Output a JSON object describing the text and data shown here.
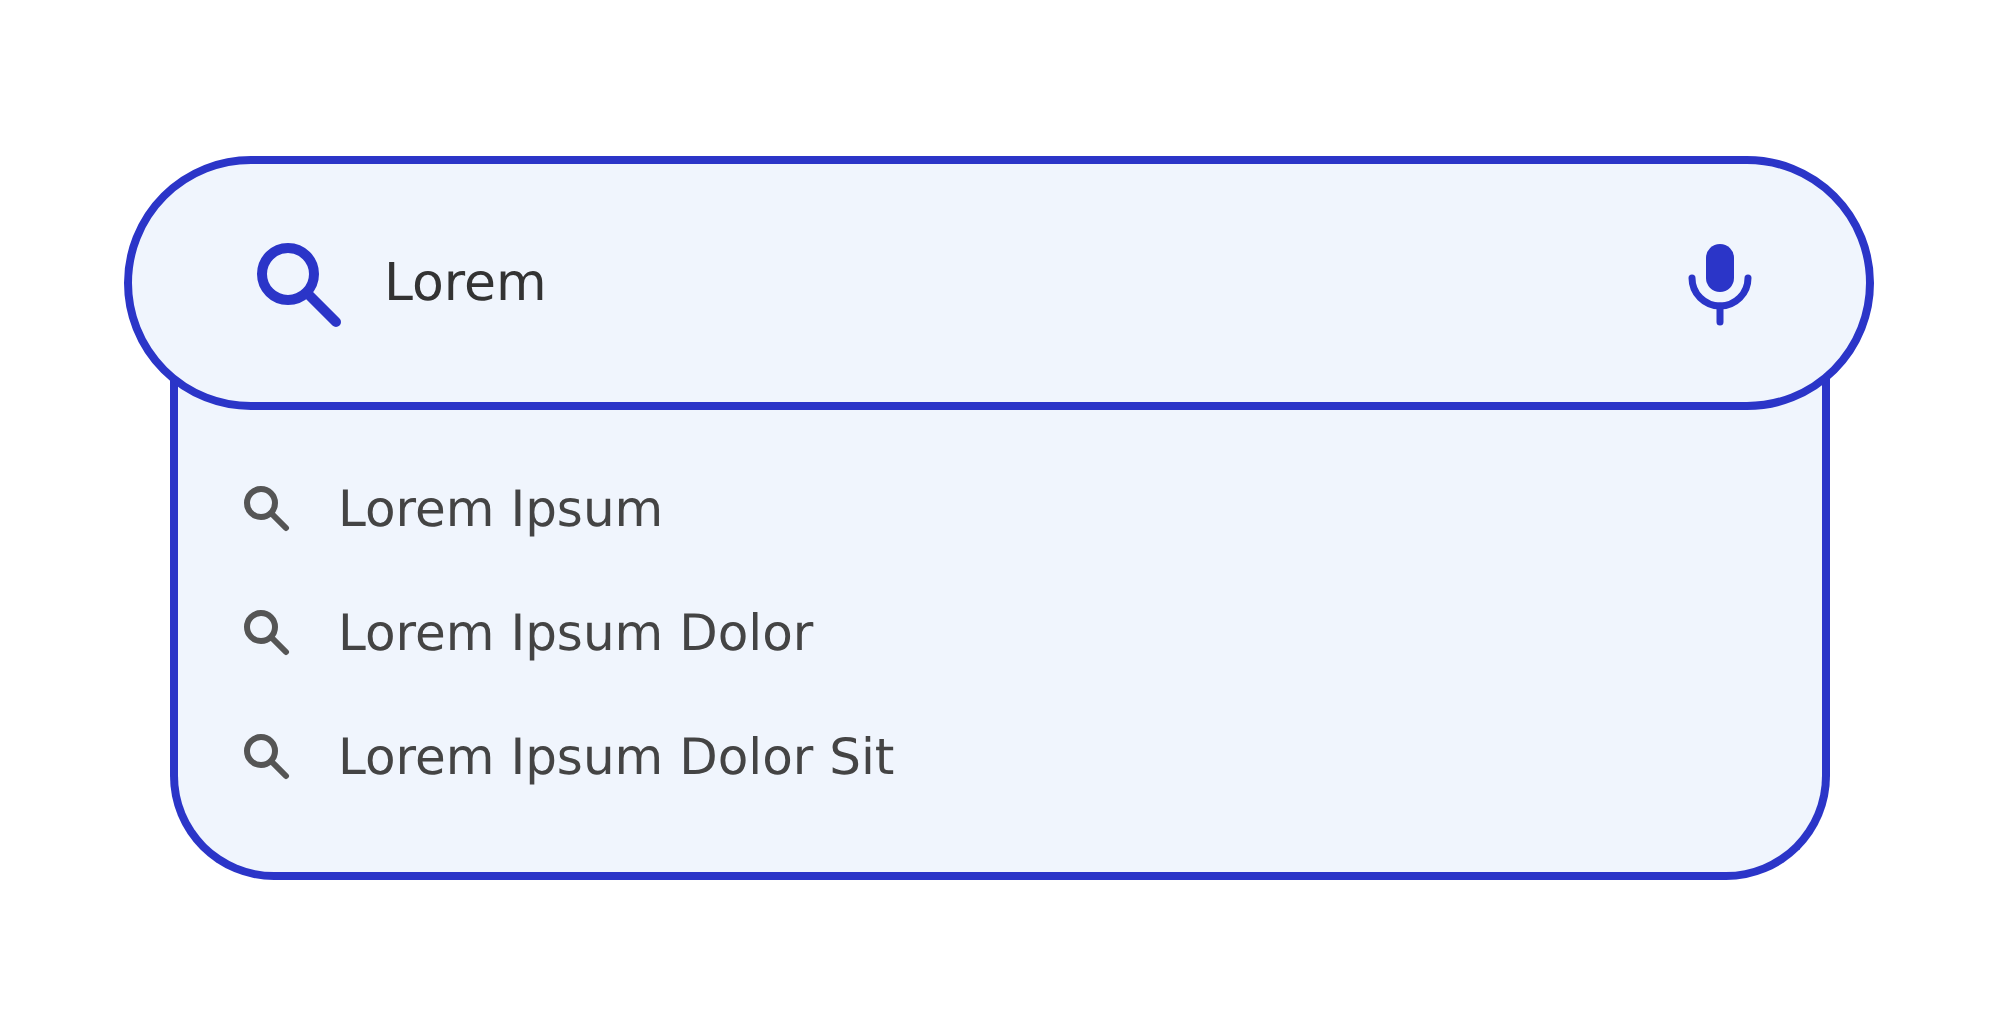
{
  "search": {
    "value": "Lorem"
  },
  "suggestions": [
    {
      "text": "Lorem Ipsum"
    },
    {
      "text": "Lorem Ipsum Dolor"
    },
    {
      "text": "Lorem Ipsum Dolor Sit"
    }
  ]
}
